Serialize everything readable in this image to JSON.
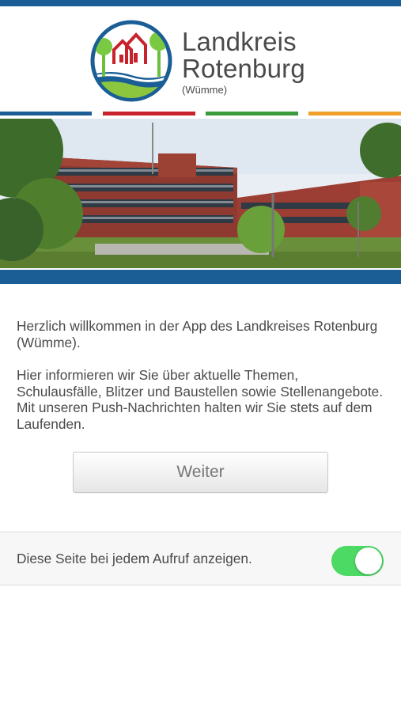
{
  "logo": {
    "line1": "Landkreis",
    "line2": "Rotenburg",
    "line3": "(Wümme)"
  },
  "colors": {
    "brand_blue": "#1b5e96",
    "bar_red": "#c8232c",
    "bar_green": "#3a9a3c",
    "bar_orange": "#f0a02a",
    "toggle_on": "#4cd964"
  },
  "intro": {
    "paragraph1": "Herzlich willkommen in der App des Landkreises Rotenburg (Wümme).",
    "paragraph2": "Hier informieren wir Sie über aktuelle Themen, Schulausfälle, Blitzer und Baustellen sowie Stellenangebote. Mit unseren Push-Nachrichten halten wir Sie stets auf dem Laufenden."
  },
  "actions": {
    "continue_label": "Weiter"
  },
  "settings": {
    "show_on_launch_label": "Diese Seite bei jedem Aufruf anzeigen.",
    "show_on_launch_enabled": true
  },
  "icons": {
    "logo": "landkreis-rotenburg-logo-icon"
  }
}
